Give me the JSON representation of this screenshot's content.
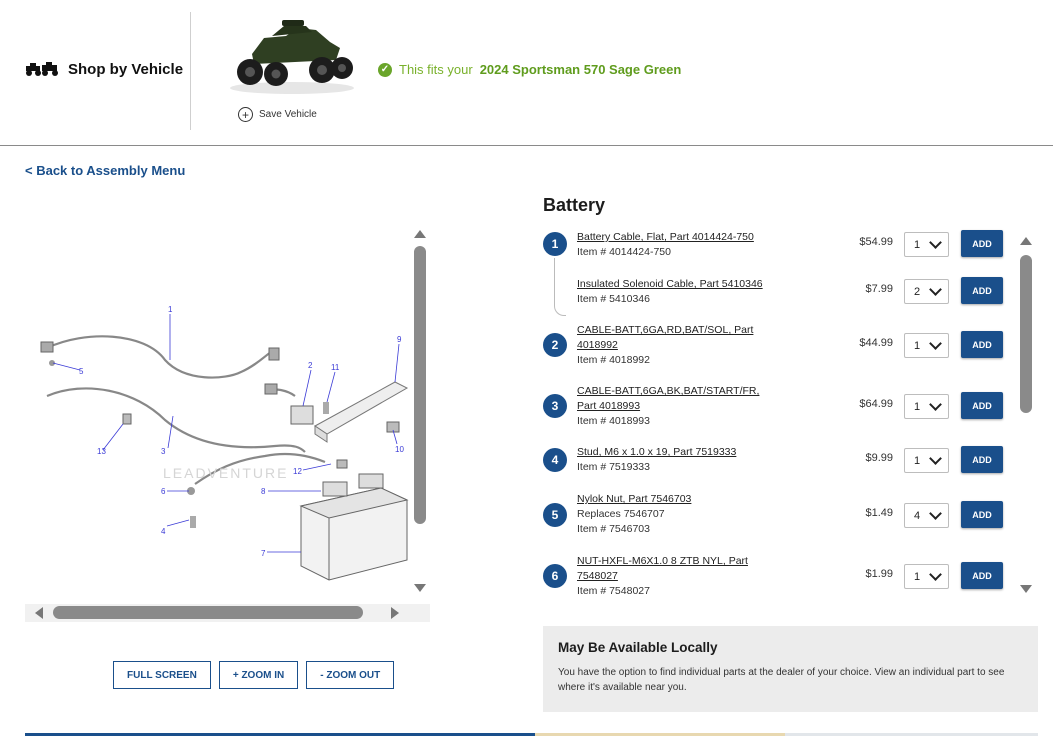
{
  "header": {
    "shop_by_vehicle": "Shop by Vehicle",
    "save_vehicle": "Save Vehicle",
    "fits_prefix": "This fits your",
    "fits_vehicle": "2024 Sportsman 570 Sage Green"
  },
  "nav": {
    "back_link": "< Back to Assembly Menu"
  },
  "diagram": {
    "watermark": "LEADVENTURE",
    "callouts": [
      "1",
      "2",
      "3",
      "4",
      "5",
      "6",
      "7",
      "8",
      "9",
      "10",
      "11",
      "12",
      "13"
    ]
  },
  "zoom": {
    "full_screen": "FULL SCREEN",
    "zoom_in": "+ ZOOM IN",
    "zoom_out": "- ZOOM OUT"
  },
  "section_title": "Battery",
  "parts": [
    {
      "num": "1",
      "name": "Battery Cable, Flat, Part 4014424-750",
      "extra": "",
      "item": "Item # 4014424-750",
      "price": "$54.99",
      "qty": "1",
      "add": "ADD"
    },
    {
      "num": "",
      "name": "Insulated Solenoid Cable, Part 5410346",
      "extra": "",
      "item": "Item # 5410346",
      "price": "$7.99",
      "qty": "2",
      "add": "ADD"
    },
    {
      "num": "2",
      "name": "CABLE-BATT,6GA,RD,BAT/SOL, Part 4018992",
      "extra": "",
      "item": "Item # 4018992",
      "price": "$44.99",
      "qty": "1",
      "add": "ADD"
    },
    {
      "num": "3",
      "name": "CABLE-BATT,6GA,BK,BAT/START/FR, Part 4018993",
      "extra": "",
      "item": "Item # 4018993",
      "price": "$64.99",
      "qty": "1",
      "add": "ADD"
    },
    {
      "num": "4",
      "name": "Stud, M6 x 1.0 x 19, Part 7519333",
      "extra": "",
      "item": "Item # 7519333",
      "price": "$9.99",
      "qty": "1",
      "add": "ADD"
    },
    {
      "num": "5",
      "name": "Nylok Nut, Part 7546703",
      "extra": "Replaces 7546707",
      "item": "Item # 7546703",
      "price": "$1.49",
      "qty": "4",
      "add": "ADD"
    },
    {
      "num": "6",
      "name": "NUT-HXFL-M6X1.0 8 ZTB NYL, Part 7548027",
      "extra": "",
      "item": "Item # 7548027",
      "price": "$1.99",
      "qty": "1",
      "add": "ADD"
    }
  ],
  "local": {
    "title": "May Be Available Locally",
    "body": "You have the option to find individual parts at the dealer of your choice. View an individual part to see where it's available near you."
  },
  "colors": {
    "brand_blue": "#1a4f8b",
    "fit_green": "#5f9c1d"
  }
}
